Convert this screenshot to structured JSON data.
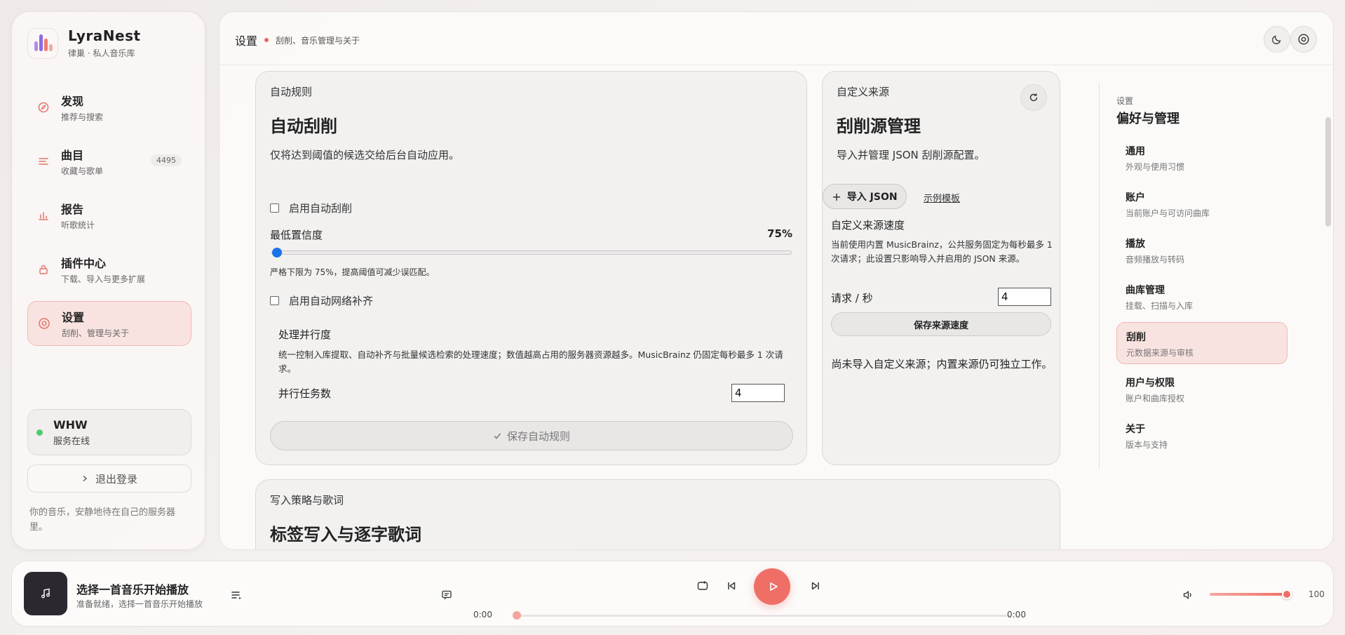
{
  "brand": {
    "name": "LyraNest",
    "subtitle": "律巢 · 私人音乐库"
  },
  "sidebar": {
    "items": [
      {
        "label": "发现",
        "sub": "推荐与搜索",
        "icon": "compass-icon"
      },
      {
        "label": "曲目",
        "sub": "收藏与歌单",
        "icon": "list-icon",
        "badge": "4495"
      },
      {
        "label": "报告",
        "sub": "听歌统计",
        "icon": "bar-chart-icon"
      },
      {
        "label": "插件中心",
        "sub": "下载、导入与更多扩展",
        "icon": "lock-icon"
      },
      {
        "label": "设置",
        "sub": "刮削、管理与关于",
        "icon": "settings-icon",
        "active": true
      }
    ],
    "user": {
      "name": "WHW",
      "status": "服务在线"
    },
    "logout_label": "退出登录",
    "tagline": "你的音乐，安静地待在自己的服务器里。"
  },
  "topbar": {
    "title": "设置",
    "subtitle": "刮削、音乐管理与关于"
  },
  "auto_rules": {
    "kicker": "自动规则",
    "title": "自动刮削",
    "desc": "仅将达到阈值的候选交给后台自动应用。",
    "enable_label": "启用自动刮削",
    "confidence_label": "最低置信度",
    "confidence_value": "75%",
    "confidence_level": 0,
    "confidence_hint": "严格下限为 75%，提高阈值可减少误匹配。",
    "network_label": "启用自动网络补齐",
    "concurrency_title": "处理并行度",
    "concurrency_desc": "统一控制入库提取、自动补齐与批量候选检索的处理速度；数值越高占用的服务器资源越多。MusicBrainz 仍固定每秒最多 1 次请求。",
    "task_label": "并行任务数",
    "task_value": "4",
    "save_label": "保存自动规则"
  },
  "sources": {
    "kicker": "自定义来源",
    "title": "刮削源管理",
    "desc": "导入并管理 JSON 刮削源配置。",
    "import_label": "导入 JSON",
    "template_label": "示例模板",
    "speed_title": "自定义来源速度",
    "speed_desc": "当前使用内置 MusicBrainz，公共服务固定为每秒最多 1 次请求；此设置只影响导入并启用的 JSON 来源。",
    "rate_label": "请求 / 秒",
    "rate_value": "4",
    "save_label": "保存来源速度",
    "empty_text": "尚未导入自定义来源；内置来源仍可独立工作。"
  },
  "write_strategy": {
    "kicker": "写入策略与歌词",
    "title": "标签写入与逐字歌词"
  },
  "settings_nav": {
    "kicker": "设置",
    "title": "偏好与管理",
    "items": [
      {
        "label": "通用",
        "desc": "外观与使用习惯"
      },
      {
        "label": "账户",
        "desc": "当前账户与可访问曲库"
      },
      {
        "label": "播放",
        "desc": "音频播放与转码"
      },
      {
        "label": "曲库管理",
        "desc": "挂载、扫描与入库"
      },
      {
        "label": "刮削",
        "desc": "元数据来源与审核",
        "active": true
      },
      {
        "label": "用户与权限",
        "desc": "账户和曲库授权"
      },
      {
        "label": "关于",
        "desc": "版本与支持"
      }
    ]
  },
  "player": {
    "title": "选择一首音乐开始播放",
    "subtitle": "准备就绪，选择一首音乐开始播放",
    "time_current": "0:00",
    "time_total": "0:00",
    "progress": 0,
    "volume": "100",
    "volume_level": 1.0
  },
  "colors": {
    "accent": "#ef6f66",
    "active_bg": "#f9e3e1",
    "online": "#4ccc6e",
    "slider_thumb": "#1a73e8"
  }
}
